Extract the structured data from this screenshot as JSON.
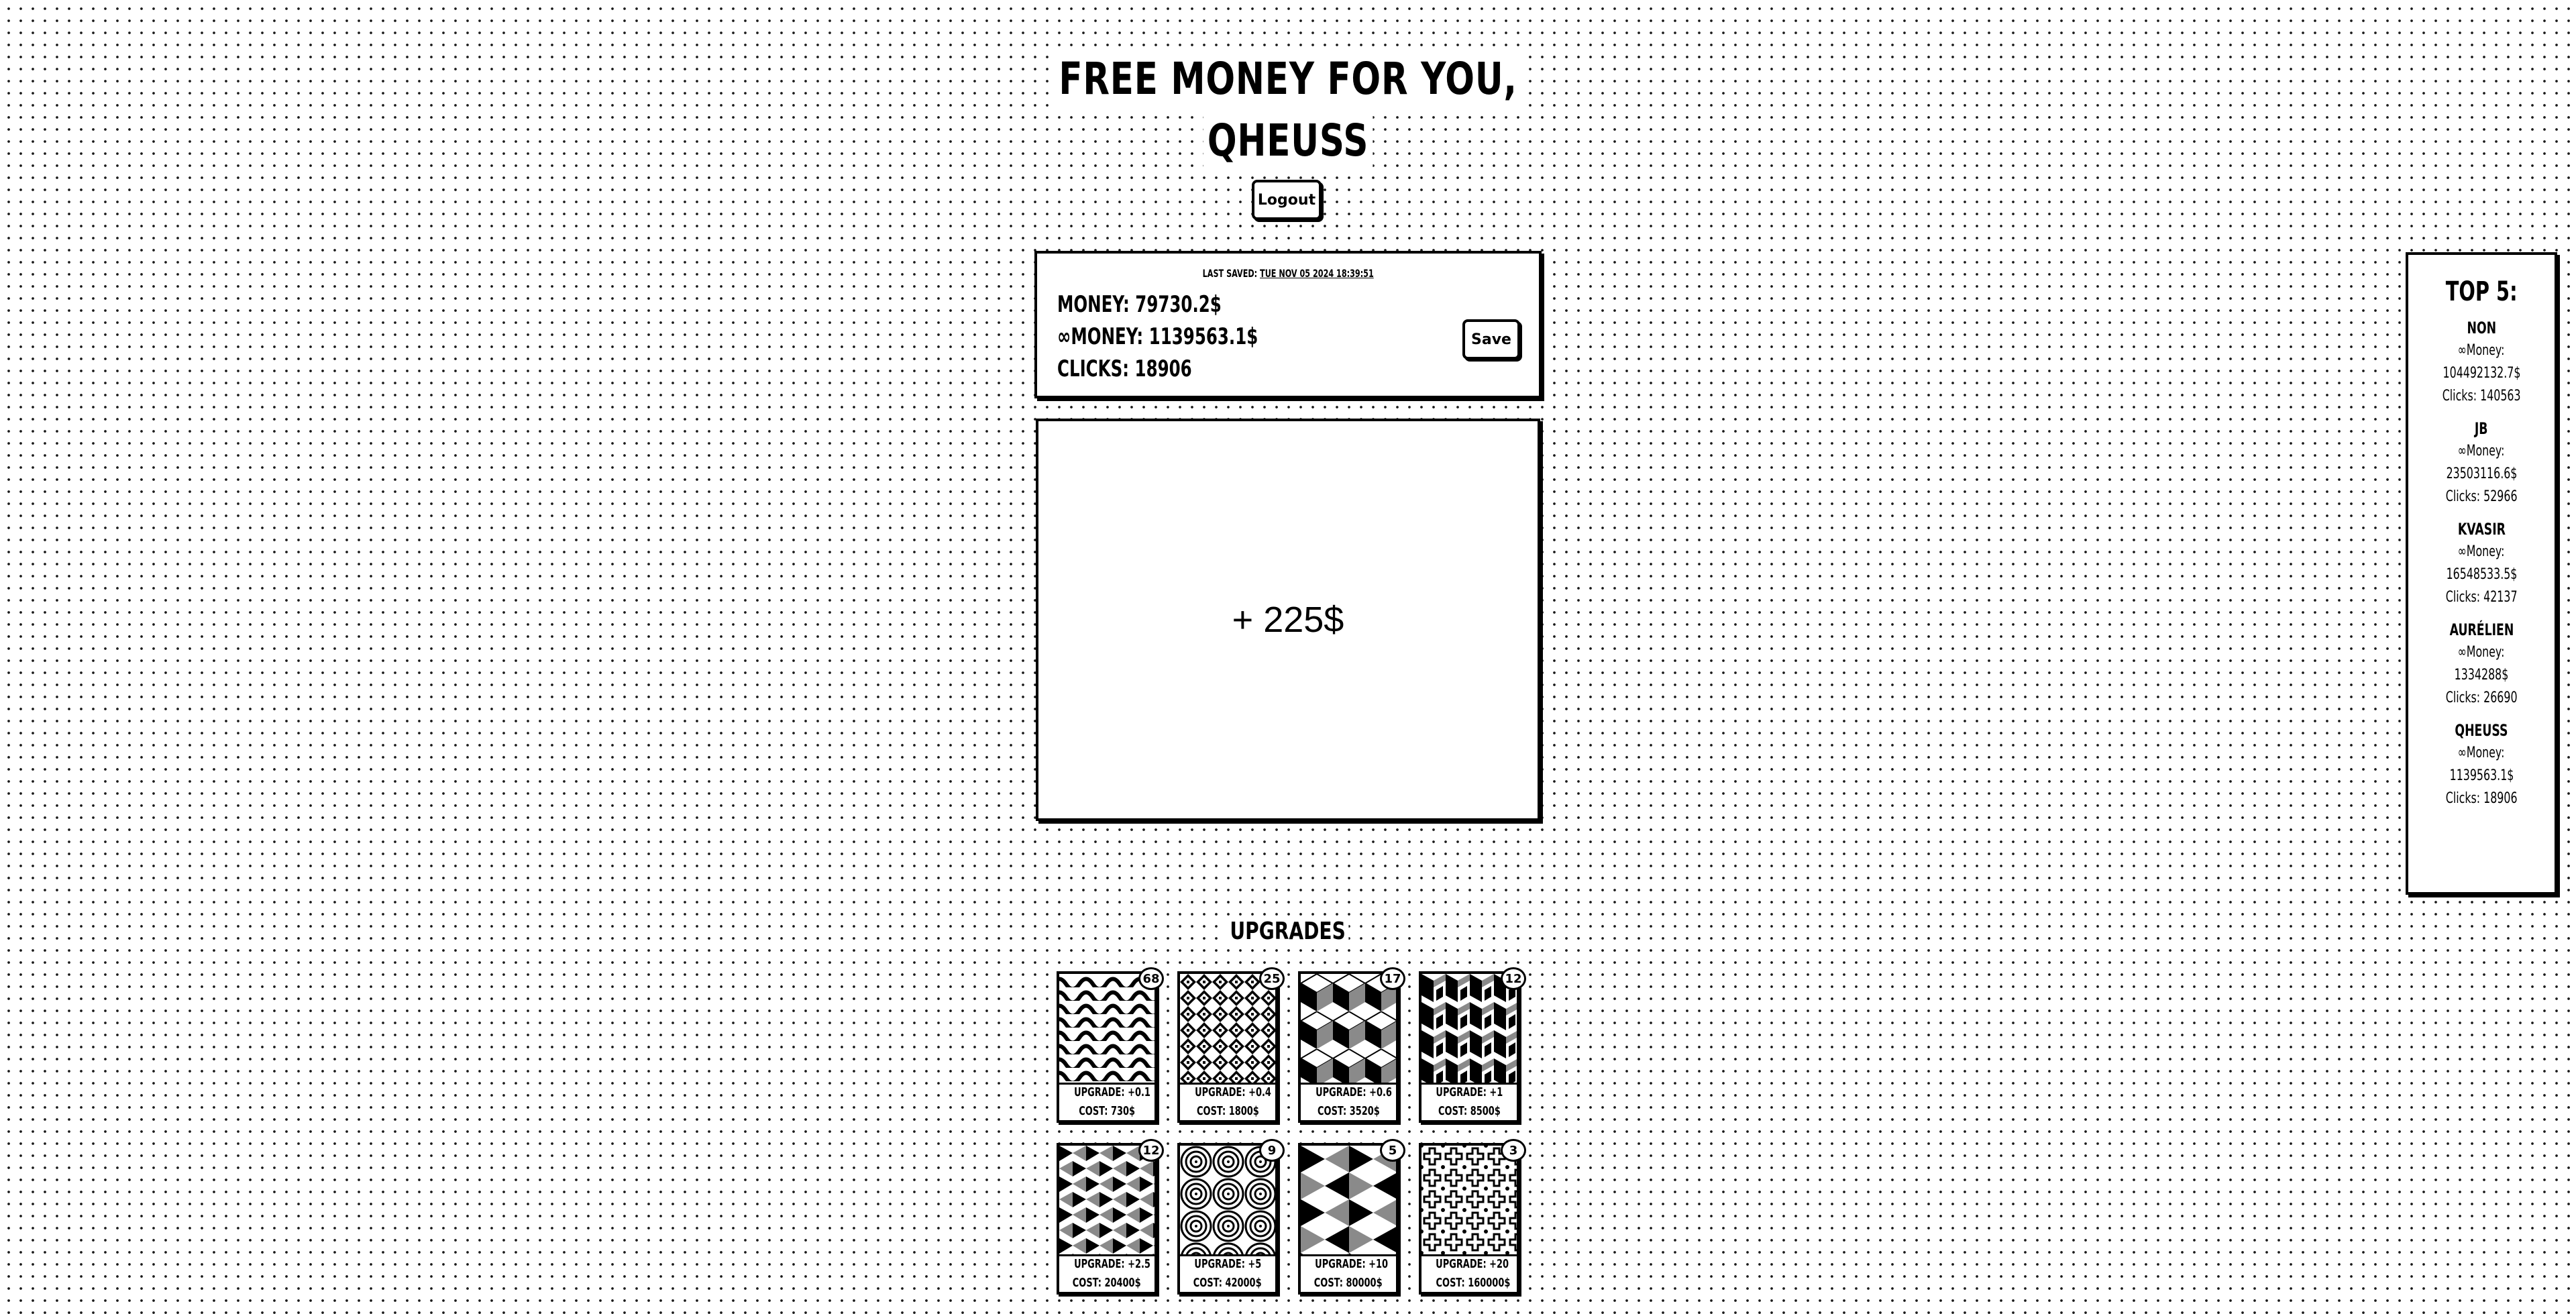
{
  "header": {
    "title_line1": "FREE MONEY FOR YOU,",
    "title_line2": "QHEUSS",
    "logout_label": "Logout"
  },
  "stats": {
    "last_saved_label": "LAST SAVED:",
    "last_saved_value": "TUE NOV 05 2024 18:39:51",
    "money": "MONEY: 79730.2$",
    "infinite_money": "∞MONEY: 1139563.1$",
    "clicks": "CLICKS: 18906",
    "save_label": "Save"
  },
  "click_area": {
    "gain_text": "+ 225$"
  },
  "upgrades": {
    "title": "UPGRADES",
    "items": [
      {
        "count": "68",
        "upgrade": "UPGRADE: +0.1",
        "cost": "COST: 730$",
        "pattern": "waves"
      },
      {
        "count": "25",
        "upgrade": "UPGRADE: +0.4",
        "cost": "COST: 1800$",
        "pattern": "diamond-lattice"
      },
      {
        "count": "17",
        "upgrade": "UPGRADE: +0.6",
        "cost": "COST: 3520$",
        "pattern": "cubes"
      },
      {
        "count": "12",
        "upgrade": "UPGRADE: +1",
        "cost": "COST: 8500$",
        "pattern": "iso-blocks"
      },
      {
        "count": "12",
        "upgrade": "UPGRADE: +2.5",
        "cost": "COST: 20400$",
        "pattern": "triangles"
      },
      {
        "count": "9",
        "upgrade": "UPGRADE: +5",
        "cost": "COST: 42000$",
        "pattern": "concentric-circles"
      },
      {
        "count": "5",
        "upgrade": "UPGRADE: +10",
        "cost": "COST: 80000$",
        "pattern": "shaded-triangles"
      },
      {
        "count": "3",
        "upgrade": "UPGRADE: +20",
        "cost": "COST: 160000$",
        "pattern": "crosses"
      }
    ]
  },
  "leaderboard": {
    "title": "TOP 5:",
    "entries": [
      {
        "name": "NON",
        "money_label": "∞Money:",
        "money": "104492132.7$",
        "clicks": "Clicks: 140563"
      },
      {
        "name": "JB",
        "money_label": "∞Money:",
        "money": "23503116.6$",
        "clicks": "Clicks: 52966"
      },
      {
        "name": "KVASIR",
        "money_label": "∞Money:",
        "money": "16548533.5$",
        "clicks": "Clicks: 42137"
      },
      {
        "name": "AURÉLIEN",
        "money_label": "∞Money:",
        "money": "1334288$",
        "clicks": "Clicks: 26690"
      },
      {
        "name": "QHEUSS",
        "money_label": "∞Money:",
        "money": "1139563.1$",
        "clicks": "Clicks: 18906"
      }
    ]
  },
  "colors": {
    "background": "#ffffff",
    "ink": "#000000",
    "dot": "#1a1a1a",
    "shade_gray": "#8a8a8a"
  }
}
